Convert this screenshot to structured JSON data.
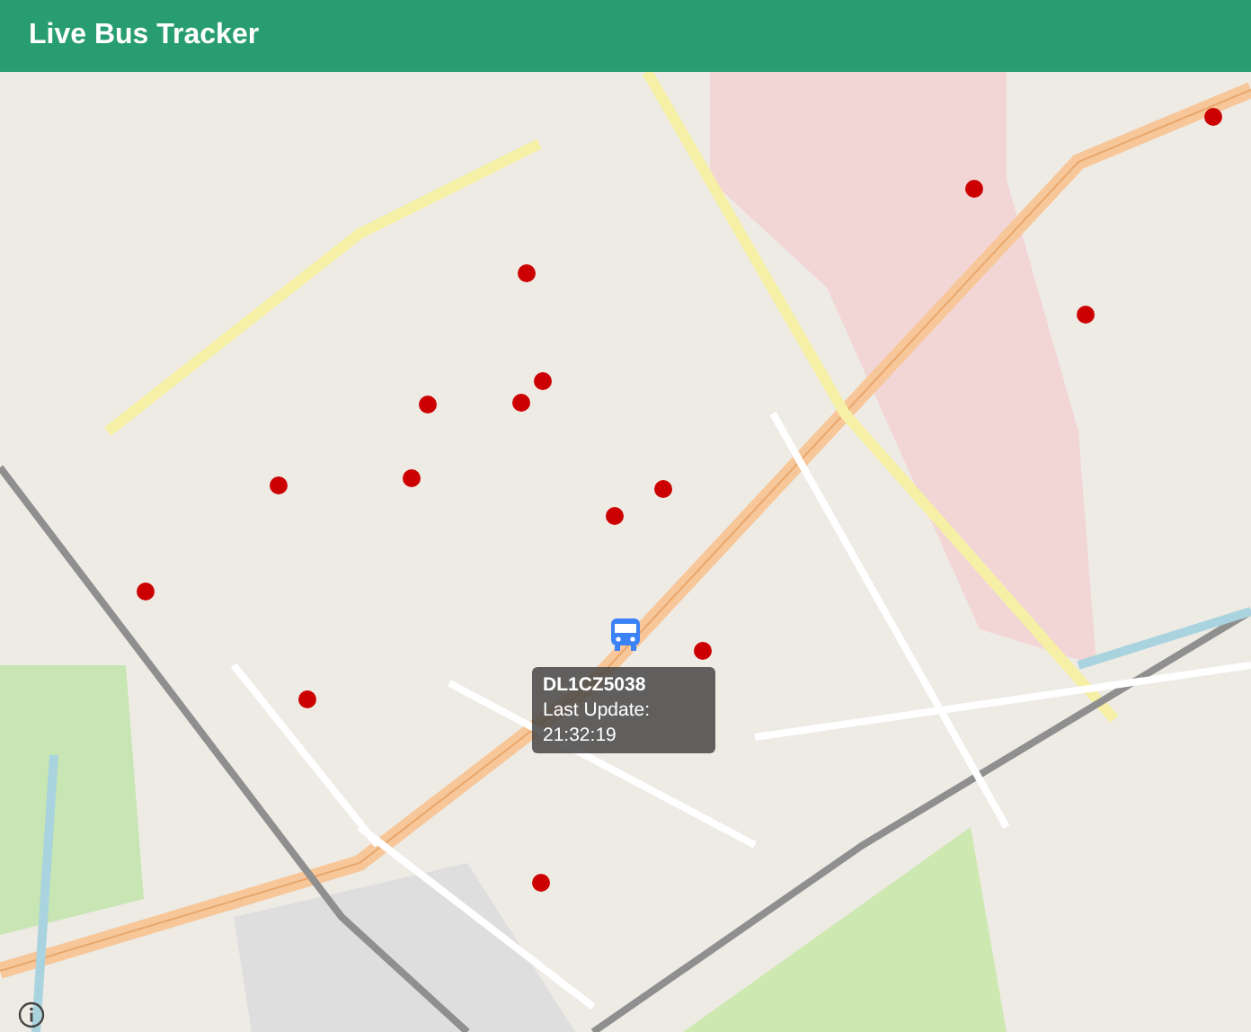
{
  "header": {
    "title": "Live Bus Tracker"
  },
  "bus": {
    "vehicle": "DL1CZ5038",
    "last_update": "Last Update: 21:32:19"
  }
}
